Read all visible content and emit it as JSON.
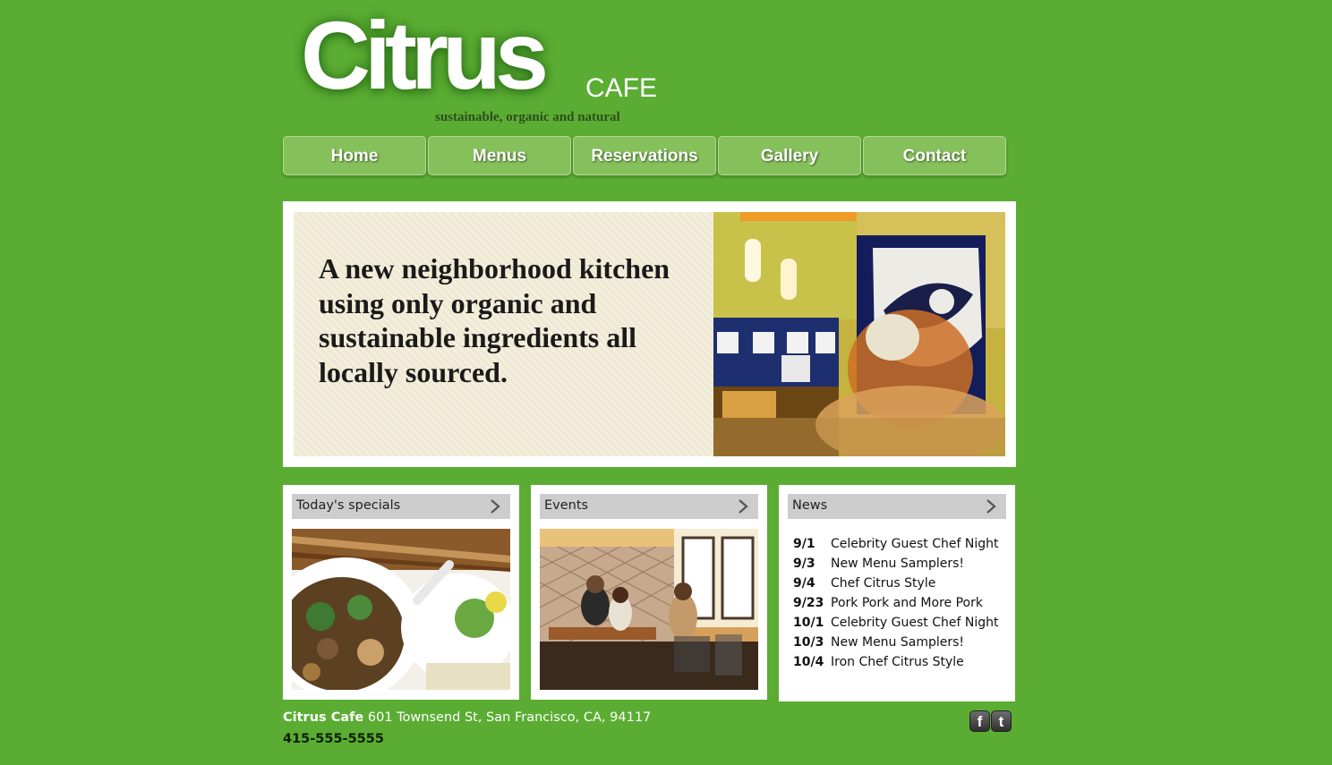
{
  "logo": {
    "word": "Citrus",
    "sub": "CAFE",
    "tagline": "sustainable, organic and natural"
  },
  "nav": [
    {
      "label": "Home"
    },
    {
      "label": "Menus"
    },
    {
      "label": "Reservations"
    },
    {
      "label": "Gallery"
    },
    {
      "label": "Contact"
    }
  ],
  "hero": {
    "text": "A new neighborhood kitchen using only organic and sustainable ingredients all locally sourced."
  },
  "panels": {
    "specials": {
      "title": "Today's specials"
    },
    "events": {
      "title": "Events"
    },
    "news": {
      "title": "News",
      "items": [
        {
          "date": "9/1",
          "text": "Celebrity Guest Chef Night"
        },
        {
          "date": "9/3",
          "text": "New Menu Samplers!"
        },
        {
          "date": "9/4",
          "text": "Chef Citrus Style"
        },
        {
          "date": "9/23",
          "text": "Pork Pork and More Pork"
        },
        {
          "date": "10/1",
          "text": "Celebrity Guest Chef Night"
        },
        {
          "date": "10/3",
          "text": "New Menu Samplers!"
        },
        {
          "date": "10/4",
          "text": "Iron Chef Citrus Style"
        }
      ]
    }
  },
  "footer": {
    "name": "Citrus Cafe",
    "address": "601 Townsend St, San Francisco, CA, 94117",
    "phone": "415-555-5555",
    "facebook": "f",
    "twitter": "t"
  },
  "colors": {
    "background": "#5aad32",
    "nav_button": "#86c05b",
    "panel_header": "#cdcdcd",
    "hero_panel": "#efe9d3"
  }
}
